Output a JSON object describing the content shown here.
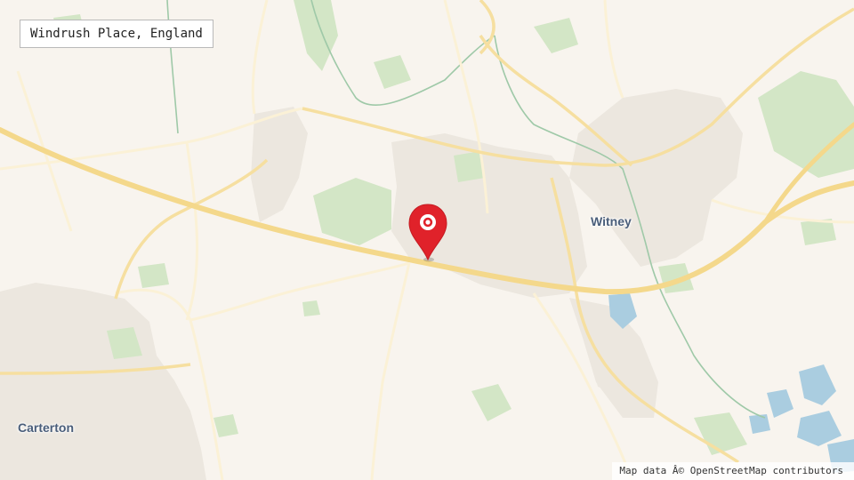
{
  "location_label": "Windrush Place, England",
  "places": {
    "witney": "Witney",
    "carterton": "Carterton"
  },
  "attribution": "Map data Â© OpenStreetMap contributors",
  "colors": {
    "background": "#f8f4ee",
    "urban": "#ece7df",
    "green": "#d3e6c6",
    "water": "#aacde0",
    "road_major": "#f4d88b",
    "road_minor": "#fbf1d6",
    "marker": "#e0222a"
  },
  "icons": {
    "marker": "map-pin-icon"
  }
}
